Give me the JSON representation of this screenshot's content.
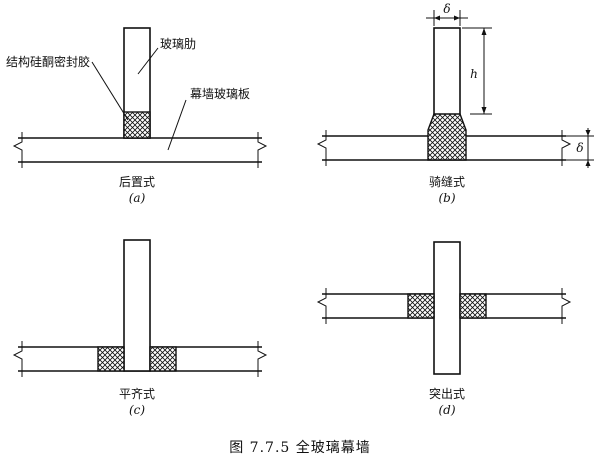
{
  "labels": {
    "sealant": "结构硅酮密封胶",
    "glass_fin": "玻璃肋",
    "curtain_panel": "幕墙玻璃板"
  },
  "panels": {
    "a": {
      "name": "后置式",
      "sub": "(a)"
    },
    "b": {
      "name": "骑缝式",
      "sub": "(b)",
      "dim_width": "δ",
      "dim_height": "h",
      "dim_thickness": "δ"
    },
    "c": {
      "name": "平齐式",
      "sub": "(c)"
    },
    "d": {
      "name": "突出式",
      "sub": "(d)"
    }
  },
  "caption": "图 7.7.5   全玻璃幕墙"
}
